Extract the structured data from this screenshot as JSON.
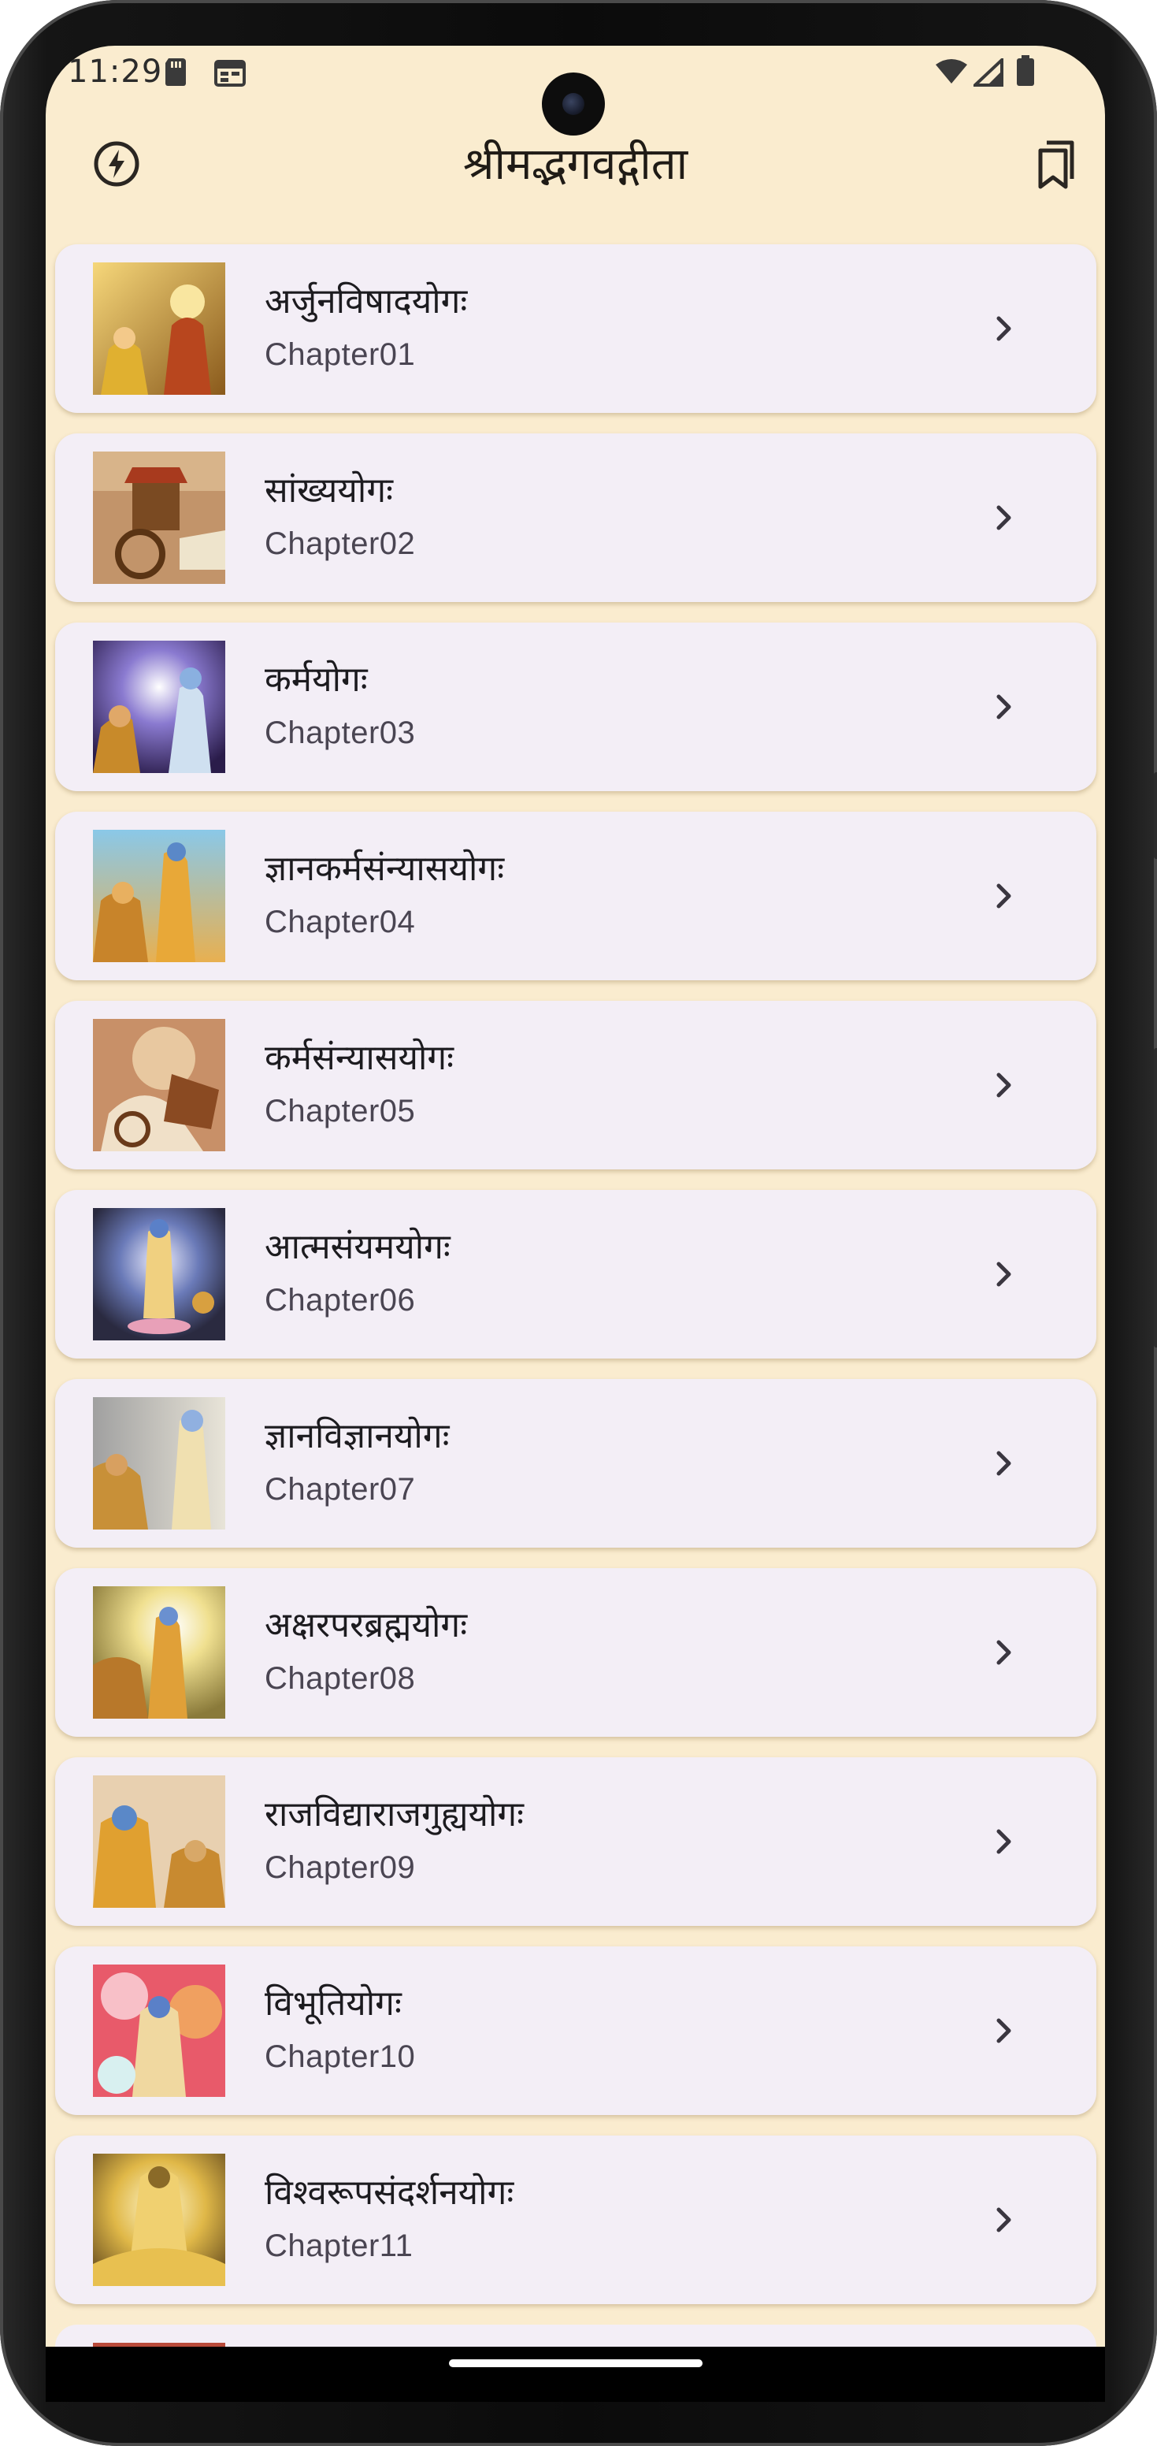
{
  "status_bar": {
    "time": "11:29",
    "icons": [
      "sd-card-icon",
      "calendar-icon",
      "wifi-icon",
      "signal-icon",
      "battery-icon"
    ]
  },
  "app_bar": {
    "title": "श्रीमद्भगवद्गीता",
    "left_icon": "flash-icon",
    "right_icon": "bookmarks-icon"
  },
  "colors": {
    "background": "#faeccf",
    "card": "#f3eef6",
    "text_primary": "#1c1b1f",
    "text_secondary": "#4a4552"
  },
  "chapters": [
    {
      "title": "अर्जुनविषादयोगः",
      "subtitle": "Chapter01",
      "icon": "chevron-right-icon"
    },
    {
      "title": "सांख्ययोगः",
      "subtitle": "Chapter02",
      "icon": "chevron-right-icon"
    },
    {
      "title": "कर्मयोगः",
      "subtitle": "Chapter03",
      "icon": "chevron-right-icon"
    },
    {
      "title": "ज्ञानकर्मसंन्यासयोगः",
      "subtitle": "Chapter04",
      "icon": "chevron-right-icon"
    },
    {
      "title": "कर्मसंन्यासयोगः",
      "subtitle": "Chapter05",
      "icon": "chevron-right-icon"
    },
    {
      "title": "आत्मसंयमयोगः",
      "subtitle": "Chapter06",
      "icon": "chevron-right-icon"
    },
    {
      "title": "ज्ञानविज्ञानयोगः",
      "subtitle": "Chapter07",
      "icon": "chevron-right-icon"
    },
    {
      "title": "अक्षरपरब्रह्मयोगः",
      "subtitle": "Chapter08",
      "icon": "chevron-right-icon"
    },
    {
      "title": "राजविद्याराजगुह्ययोगः",
      "subtitle": "Chapter09",
      "icon": "chevron-right-icon"
    },
    {
      "title": "विभूतियोगः",
      "subtitle": "Chapter10",
      "icon": "chevron-right-icon"
    },
    {
      "title": "विश्वरूपसंदर्शनयोगः",
      "subtitle": "Chapter11",
      "icon": "chevron-right-icon"
    }
  ]
}
